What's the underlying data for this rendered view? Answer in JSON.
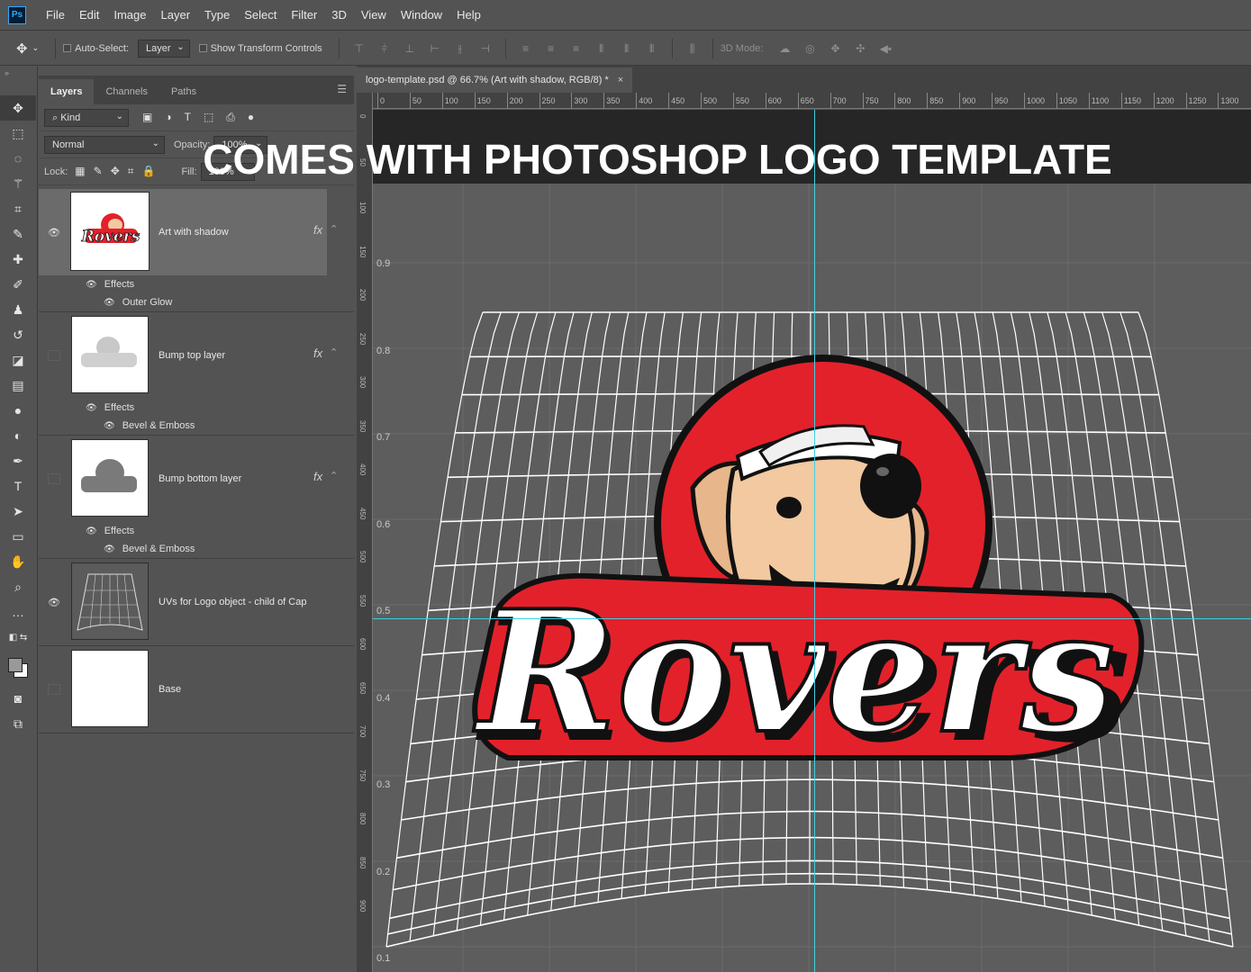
{
  "app": {
    "logo": "Ps"
  },
  "menu": [
    "File",
    "Edit",
    "Image",
    "Layer",
    "Type",
    "Select",
    "Filter",
    "3D",
    "View",
    "Window",
    "Help"
  ],
  "options": {
    "auto_select_label": "Auto-Select:",
    "auto_select_value": "Layer",
    "show_transform_label": "Show Transform Controls",
    "mode_3d_label": "3D Mode:"
  },
  "panel": {
    "tabs": [
      "Layers",
      "Channels",
      "Paths"
    ],
    "filter_kind": "Kind",
    "blend_mode": "Normal",
    "opacity_label": "Opacity:",
    "opacity_value": "100%",
    "lock_label": "Lock:",
    "fill_label": "Fill:",
    "fill_value": "100%"
  },
  "layers": [
    {
      "name": "Art with shadow",
      "visible": true,
      "selected": true,
      "fx": "fx",
      "effects_label": "Effects",
      "effect": "Outer Glow"
    },
    {
      "name": "Bump top layer",
      "visible": false,
      "selected": false,
      "fx": "fx",
      "effects_label": "Effects",
      "effect": "Bevel & Emboss"
    },
    {
      "name": "Bump bottom layer",
      "visible": false,
      "selected": false,
      "fx": "fx",
      "effects_label": "Effects",
      "effect": "Bevel & Emboss"
    },
    {
      "name": "UVs for Logo object - child of Cap",
      "visible": true,
      "selected": false
    },
    {
      "name": "Base",
      "visible": false,
      "selected": false
    }
  ],
  "document": {
    "tab_title": "logo-template.psd @ 66.7% (Art with shadow, RGB/8) *",
    "close": "×"
  },
  "rulers": {
    "top": [
      "0",
      "50",
      "100",
      "150",
      "200",
      "250",
      "300",
      "350",
      "400",
      "450",
      "500",
      "550",
      "600",
      "650",
      "700",
      "750",
      "800",
      "850",
      "900",
      "950",
      "1000",
      "1050",
      "1100",
      "1150",
      "1200",
      "1250",
      "1300"
    ],
    "left": [
      "0",
      "50",
      "100",
      "150",
      "200",
      "250",
      "300",
      "350",
      "400",
      "450",
      "500",
      "550",
      "600",
      "650",
      "700",
      "750",
      "800",
      "850",
      "900"
    ]
  },
  "canvas": {
    "banner": "COMES WITH PHOTOSHOP LOGO TEMPLATE",
    "y_ticks": [
      "0.9",
      "0.8",
      "0.7",
      "0.6",
      "0.5",
      "0.4",
      "0.3",
      "0.2",
      "0.1"
    ],
    "logo_text": "Rovers",
    "colors": {
      "red": "#e3212b",
      "skin": "#f2c9a0",
      "tongue": "#c79ac9",
      "guide": "#3fd0e0"
    }
  }
}
